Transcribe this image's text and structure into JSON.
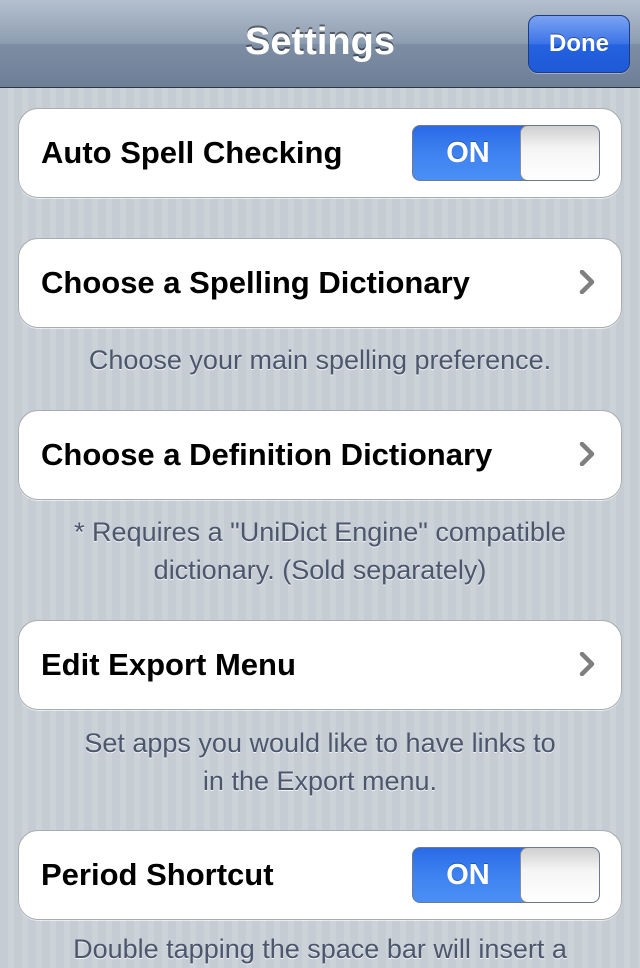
{
  "navbar": {
    "title": "Settings",
    "done_label": "Done"
  },
  "cells": {
    "auto_spell": {
      "label": "Auto Spell Checking",
      "toggle_label": "ON",
      "toggle_on": true
    },
    "spelling_dict": {
      "label": "Choose a Spelling Dictionary",
      "footer": "Choose your main spelling preference."
    },
    "definition_dict": {
      "label": "Choose a Definition Dictionary",
      "footer_line1": "* Requires a \"UniDict Engine\" compatible",
      "footer_line2": "dictionary. (Sold separately)"
    },
    "export_menu": {
      "label": "Edit Export Menu",
      "footer_line1": "Set apps you would like to have links to",
      "footer_line2": "in the Export menu."
    },
    "period_shortcut": {
      "label": "Period Shortcut",
      "toggle_label": "ON",
      "toggle_on": true,
      "footer": "Double tapping the space bar will insert a"
    }
  },
  "icons": {
    "chevron": "chevron-right-icon"
  },
  "colors": {
    "toggle_on": "#3d82f0",
    "done_button": "#2462e0",
    "footer_text": "#4c566c"
  }
}
